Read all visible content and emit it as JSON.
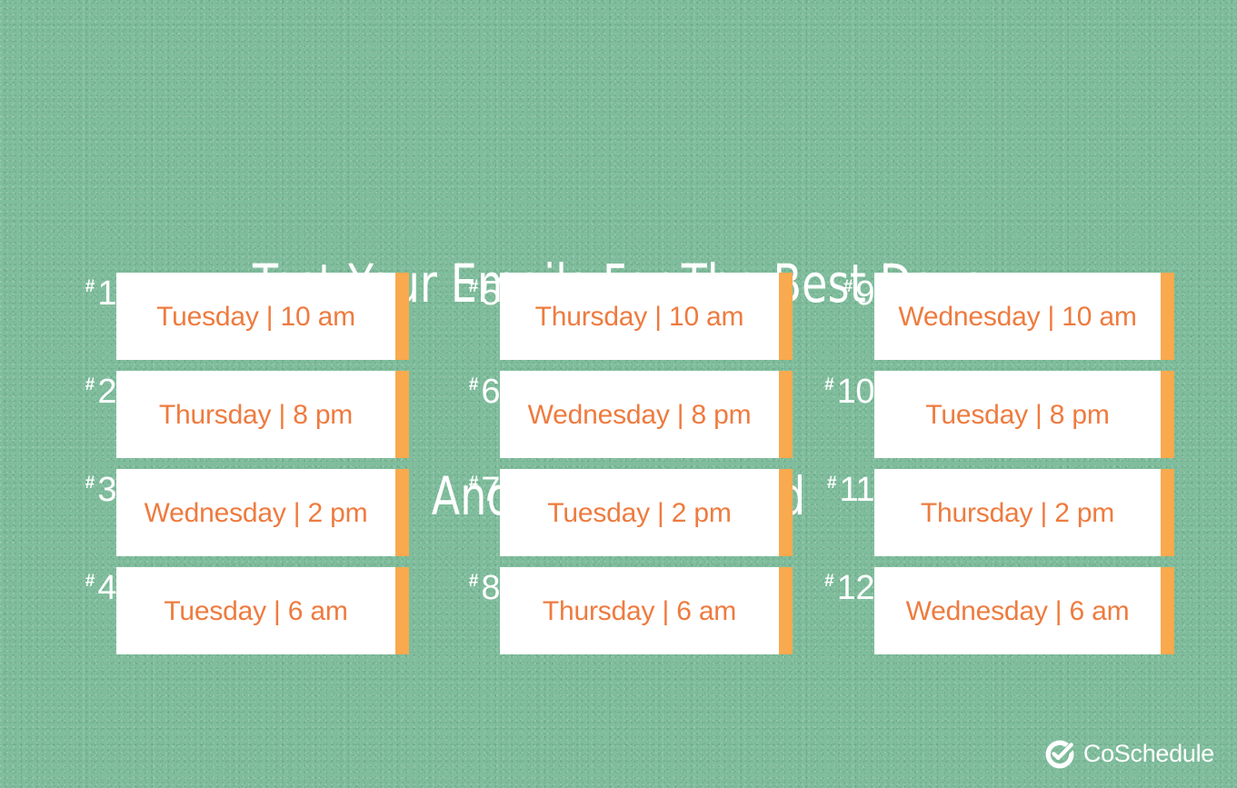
{
  "colors": {
    "background": "#7fbd9c",
    "card_face": "#ffffff",
    "card_accent_bar": "#f9a94e",
    "label_text": "#ee7b3f",
    "title_text": "#ffffff",
    "rank_text": "#ffffff"
  },
  "title": {
    "line1": "Test Your Emails For The Best Days",
    "line2": "And Time To Send"
  },
  "hash_symbol": "#",
  "columns": [
    {
      "items": [
        {
          "rank": "1",
          "label": "Tuesday | 10 am",
          "day": "Tuesday",
          "time": "10 am"
        },
        {
          "rank": "2",
          "label": "Thursday | 8 pm",
          "day": "Thursday",
          "time": "8 pm"
        },
        {
          "rank": "3",
          "label": "Wednesday | 2 pm",
          "day": "Wednesday",
          "time": "2 pm"
        },
        {
          "rank": "4",
          "label": "Tuesday | 6 am",
          "day": "Tuesday",
          "time": "6 am"
        }
      ]
    },
    {
      "items": [
        {
          "rank": "5",
          "label": "Thursday | 10 am",
          "day": "Thursday",
          "time": "10 am"
        },
        {
          "rank": "6",
          "label": "Wednesday | 8 pm",
          "day": "Wednesday",
          "time": "8 pm"
        },
        {
          "rank": "7",
          "label": "Tuesday | 2 pm",
          "day": "Tuesday",
          "time": "2 pm"
        },
        {
          "rank": "8",
          "label": "Thursday | 6 am",
          "day": "Thursday",
          "time": "6 am"
        }
      ]
    },
    {
      "items": [
        {
          "rank": "9",
          "label": "Wednesday | 10 am",
          "day": "Wednesday",
          "time": "10 am"
        },
        {
          "rank": "10",
          "label": "Tuesday | 8 pm",
          "day": "Tuesday",
          "time": "8 pm"
        },
        {
          "rank": "11",
          "label": "Thursday | 2 pm",
          "day": "Thursday",
          "time": "2 pm"
        },
        {
          "rank": "12",
          "label": "Wednesday | 6 am",
          "day": "Wednesday",
          "time": "6 am"
        }
      ]
    }
  ],
  "logo": {
    "icon": "coschedule-check-circle-icon",
    "wordmark": "CoSchedule"
  }
}
